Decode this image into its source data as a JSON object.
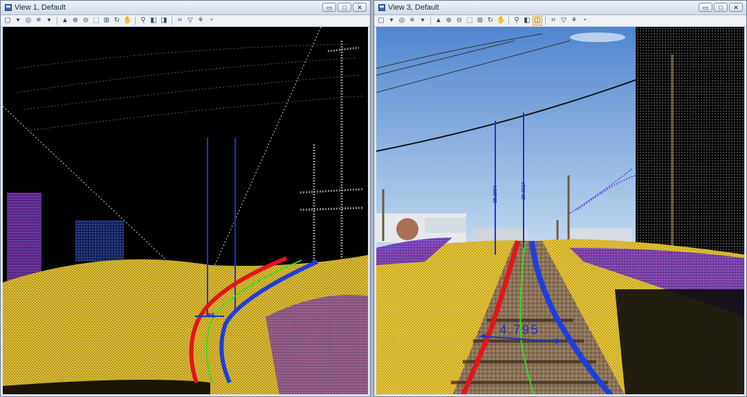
{
  "windows": [
    {
      "title": "View 1, Default",
      "measure": {
        "dimension_label": "4.795"
      }
    },
    {
      "title": "View 3, Default",
      "measure": {
        "dimension_label": "4.795",
        "height_labels": [
          "29.2004",
          "29.3617"
        ]
      }
    }
  ],
  "window_buttons": {
    "minimize": "▭",
    "maximize": "□",
    "close": "✕"
  },
  "toolbar_icons": [
    "view-attributes-icon",
    "display-style-icon",
    "render-mode-icon",
    "update-icon",
    "zoom-in-icon",
    "zoom-out-icon",
    "window-area-icon",
    "fit-view-icon",
    "rotate-icon",
    "pan-icon",
    "walk-icon",
    "previous-view-icon",
    "next-view-icon",
    "toggle-camera-icon",
    "clip-volume-icon",
    "clip-mask-icon",
    "view-display-icon"
  ],
  "colors": {
    "rail_left": "#e3151a",
    "rail_right": "#1f3fdc",
    "centerline": "#31e022",
    "measure_line": "#1e33c8",
    "ground_points": "#e8c22a",
    "sky_top": "#4f86d0"
  }
}
